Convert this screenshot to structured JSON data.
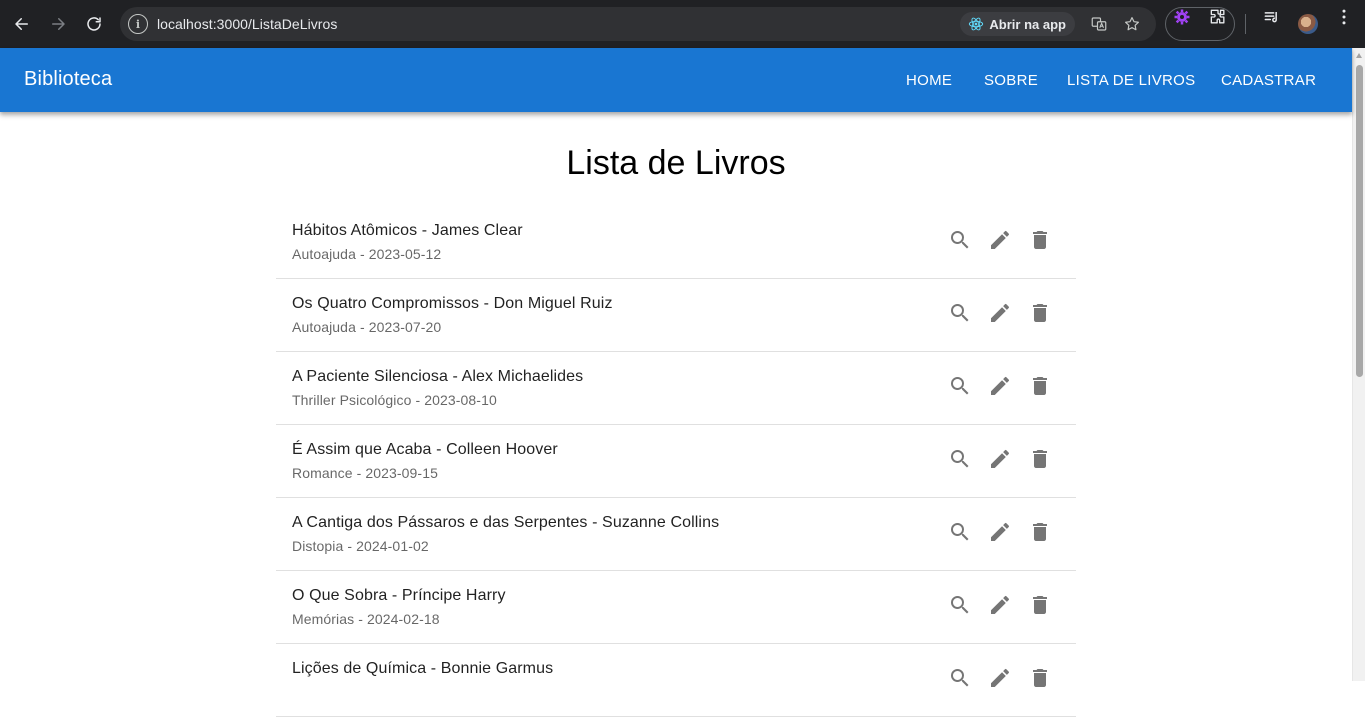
{
  "browser": {
    "url": "localhost:3000/ListaDeLivros",
    "open_in_app_label": "Abrir na app"
  },
  "appbar": {
    "brand": "Biblioteca",
    "menu": [
      {
        "label": "HOME"
      },
      {
        "label": "SOBRE"
      },
      {
        "label": "LISTA DE LIVROS"
      },
      {
        "label": "CADASTRAR"
      }
    ]
  },
  "page": {
    "title": "Lista de Livros"
  },
  "books": [
    {
      "title": "Hábitos Atômicos - James Clear",
      "subtitle": "Autoajuda - 2023-05-12"
    },
    {
      "title": "Os Quatro Compromissos - Don Miguel Ruiz",
      "subtitle": "Autoajuda - 2023-07-20"
    },
    {
      "title": "A Paciente Silenciosa - Alex Michaelides",
      "subtitle": "Thriller Psicológico - 2023-08-10"
    },
    {
      "title": "É Assim que Acaba - Colleen Hoover",
      "subtitle": "Romance - 2023-09-15"
    },
    {
      "title": "A Cantiga dos Pássaros e das Serpentes - Suzanne Collins",
      "subtitle": "Distopia - 2024-01-02"
    },
    {
      "title": "O Que Sobra - Príncipe Harry",
      "subtitle": "Memórias - 2024-02-18"
    },
    {
      "title": "Lições de Química - Bonnie Garmus",
      "subtitle": ""
    }
  ],
  "row_actions": {
    "view_icon": "search-icon",
    "edit_icon": "edit-icon",
    "delete_icon": "delete-icon"
  },
  "colors": {
    "appbar": "#1976d2",
    "icon": "#757575"
  }
}
